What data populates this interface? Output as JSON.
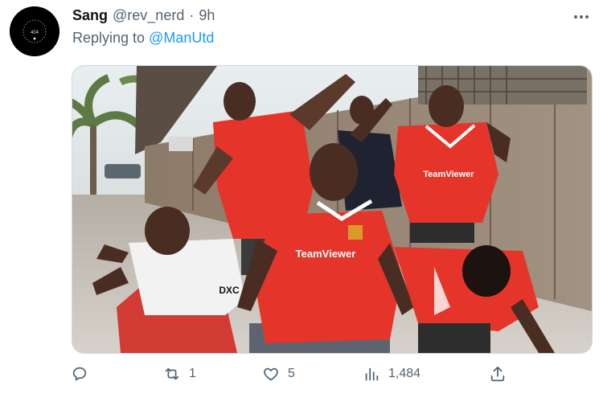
{
  "tweet": {
    "display_name": "Sang",
    "handle": "@rev_nerd",
    "separator": "·",
    "time": "9h",
    "replying_prefix": "Replying to",
    "replying_to": "@ManUtd",
    "avatar_text": "404",
    "media_text": {
      "sponsor_center": "TeamViewer",
      "sponsor_right": "TeamViewer",
      "sponsor_left": "DXC"
    }
  },
  "actions": {
    "reply_count": "",
    "retweet_count": "1",
    "like_count": "5",
    "views_count": "1,484"
  },
  "colors": {
    "accent": "#1d9bf0",
    "muted": "#536471",
    "jersey_red": "#e5352a"
  }
}
